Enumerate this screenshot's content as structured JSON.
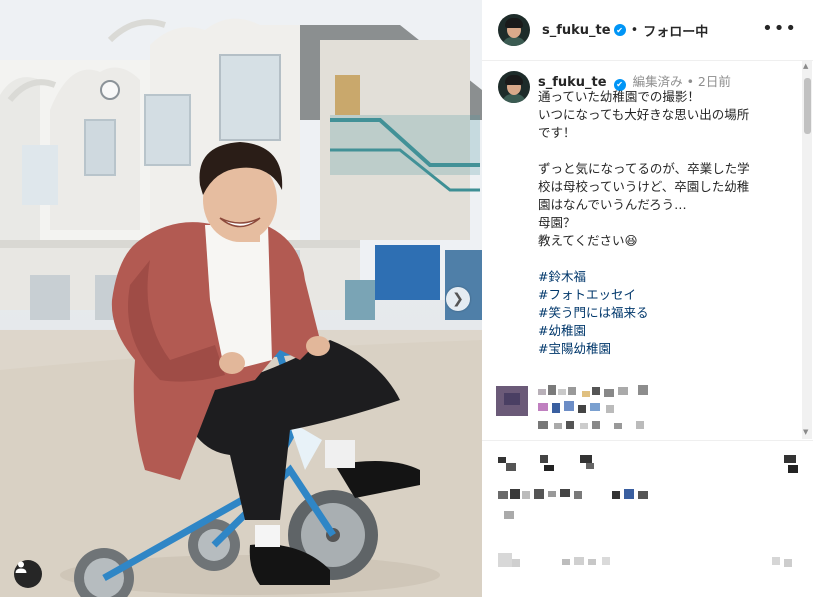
{
  "post": {
    "username": "s_fuku_te",
    "follow_label": "フォロー中",
    "more_icon": "more-horizontal-icon"
  },
  "caption": {
    "username": "s_fuku_te",
    "edited": "編集済み",
    "time": "2日前",
    "lines1": [
      "通っていた幼稚園での撮影！",
      "いつになっても大好きな思い出の場所",
      "です！"
    ],
    "lines2": [
      "ずっと気になってるのが、卒業した学",
      "校は母校っていうけど、卒園した幼稚",
      "園はなんでいうんだろう…",
      "母園？",
      "教えてください😆"
    ],
    "hashtags": [
      "#鈴木福",
      "#フォトエッセイ",
      "#笑う門には福来る",
      "#幼稚園",
      "#宝陽幼稚園"
    ]
  },
  "colors": {
    "verified": "#0095f6",
    "hashtag": "#00376b",
    "secondary_text": "#8e8e8e"
  }
}
